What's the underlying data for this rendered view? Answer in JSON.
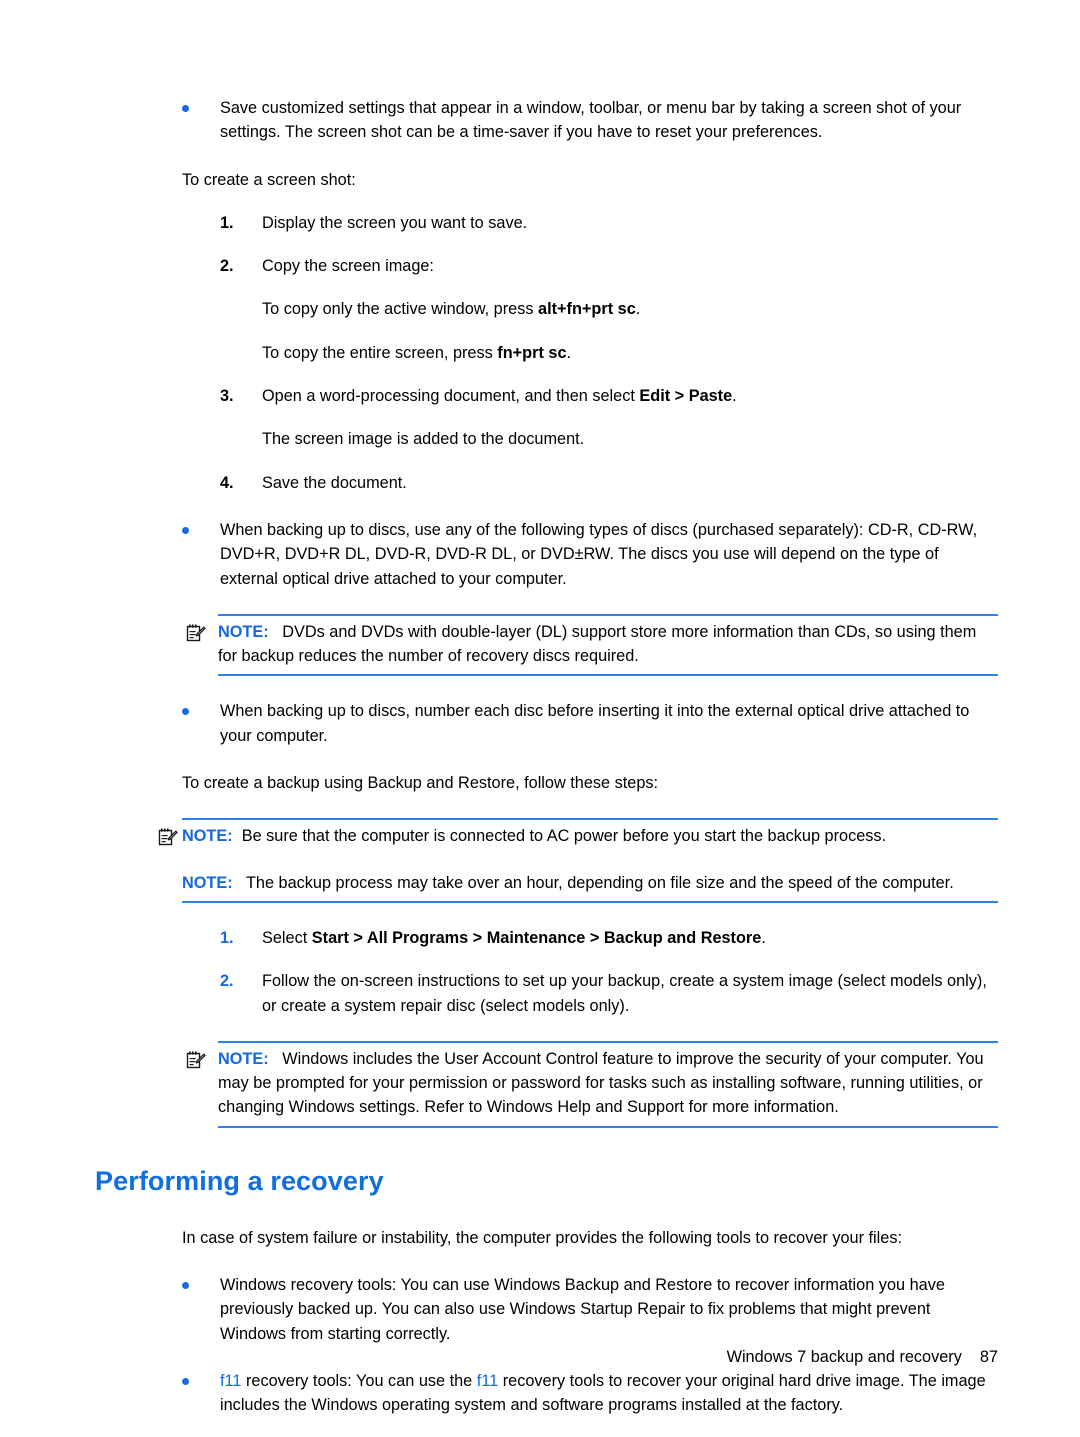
{
  "page": {
    "footer_text": "Windows 7 backup and recovery",
    "page_number": "87"
  },
  "colors": {
    "accent_blue": "#1569e0",
    "rule_blue": "#2f7fe8",
    "heading_blue": "#0f6fe0",
    "body_black": "#000000"
  },
  "blocks": {
    "bullet_save_settings": "Save customized settings that appear in a window, toolbar, or menu bar by taking a screen shot of your settings. The screen shot can be a time-saver if you have to reset your preferences.",
    "intro_create_screen_shot": "To create a screen shot:",
    "step1": {
      "num": "1.",
      "text": "Display the screen you want to save."
    },
    "step2": {
      "num": "2.",
      "text": "Copy the screen image:"
    },
    "step2_sub1_pre": "To copy only the active window, press ",
    "step2_sub1_key": "alt+fn+prt sc",
    "step2_sub1_post": ".",
    "step2_sub2_pre": "To copy the entire screen, press ",
    "step2_sub2_key": "fn+prt sc",
    "step2_sub2_post": ".",
    "step3": {
      "num": "3.",
      "pre": "Open a word-processing document, and then select ",
      "bold": "Edit > Paste",
      "post": "."
    },
    "step3_sub": "The screen image is added to the document.",
    "step4": {
      "num": "4.",
      "text": "Save the document."
    },
    "bullet_disc_types": "When backing up to discs, use any of the following types of discs (purchased separately): CD-R, CD-RW, DVD+R, DVD+R DL, DVD-R, DVD-R DL, or DVD±RW. The discs you use will depend on the type of external optical drive attached to your computer.",
    "note_dl": {
      "label": "NOTE:",
      "text": "DVDs and DVDs with double-layer (DL) support store more information than CDs, so using them for backup reduces the number of recovery discs required."
    },
    "bullet_number_discs": "When backing up to discs, number each disc before inserting it into the external optical drive attached to your computer.",
    "intro_backup_steps": "To create a backup using Backup and Restore, follow these steps:",
    "note_ac_power": {
      "label": "NOTE:",
      "text": "Be sure that the computer is connected to AC power before you start the backup process."
    },
    "note_backup_time": {
      "label": "NOTE:",
      "text": "The backup process may take over an hour, depending on file size and the speed of the computer."
    },
    "bstep1": {
      "num": "1.",
      "pre": "Select ",
      "bold": "Start > All Programs > Maintenance > Backup and Restore",
      "post": "."
    },
    "bstep2": {
      "num": "2.",
      "text": "Follow the on-screen instructions to set up your backup, create a system image (select models only), or create a system repair disc (select models only)."
    },
    "note_uac": {
      "label": "NOTE:",
      "text": "Windows includes the User Account Control feature to improve the security of your computer. You may be prompted for your permission or password for tasks such as installing software, running utilities, or changing Windows settings. Refer to Windows Help and Support for more information."
    },
    "heading_recovery": "Performing a recovery",
    "intro_recovery": "In case of system failure or instability, the computer provides the following tools to recover your files:",
    "bullet_windows_recovery": "Windows recovery tools: You can use Windows Backup and Restore to recover information you have previously backed up. You can also use Windows Startup Repair to fix problems that might prevent Windows from starting correctly.",
    "bullet_f11": {
      "link1": "f11",
      "mid": " recovery tools: You can use the ",
      "link2": "f11",
      "post": " recovery tools to recover your original hard drive image. The image includes the Windows operating system and software programs installed at the factory."
    }
  },
  "icons": {
    "note_icon": "notepad-pencil-icon",
    "bullet_icon": "bullet-dot"
  }
}
